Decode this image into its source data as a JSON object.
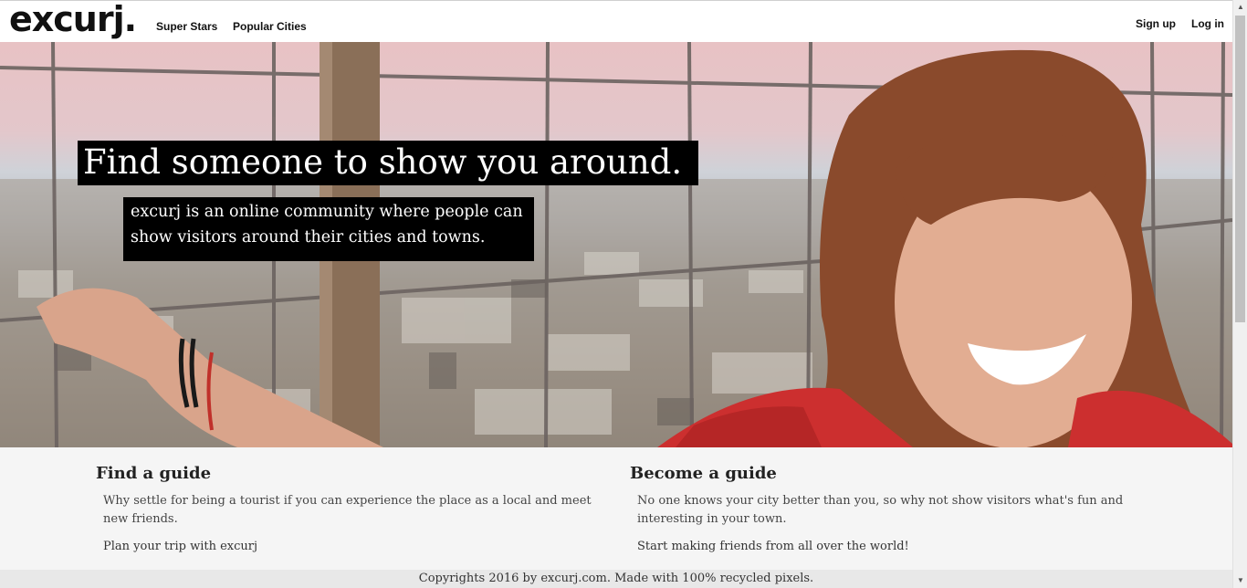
{
  "nav": {
    "logo": "excurj.",
    "super_stars": "Super Stars",
    "popular_cities": "Popular Cities",
    "sign_up": "Sign up",
    "log_in": "Log in"
  },
  "hero": {
    "headline": "Find someone to show you around.",
    "subline": "excurj is an online community where people can show visitors around their cities and towns."
  },
  "find_guide": {
    "title": "Find a guide",
    "description": "Why settle for being a tourist if you can experience the place as a local and meet new friends.",
    "cta": "Plan your trip with excurj"
  },
  "become_guide": {
    "title": "Become a guide",
    "description": "No one knows your city better than you, so why not show visitors what's fun and interesting in your town.",
    "cta": "Start making friends from all over the world!"
  },
  "footer": {
    "text": "Copyrights 2016 by excurj.com. Made with 100% recycled pixels."
  },
  "colors": {
    "accent": "#000000",
    "page_bg": "#ffffff",
    "section_bg": "#f5f5f5",
    "footer_bg": "#e8e8e8"
  },
  "icons": {
    "scroll_up": "scroll-up-arrow-icon",
    "scroll_down": "scroll-down-arrow-icon"
  }
}
